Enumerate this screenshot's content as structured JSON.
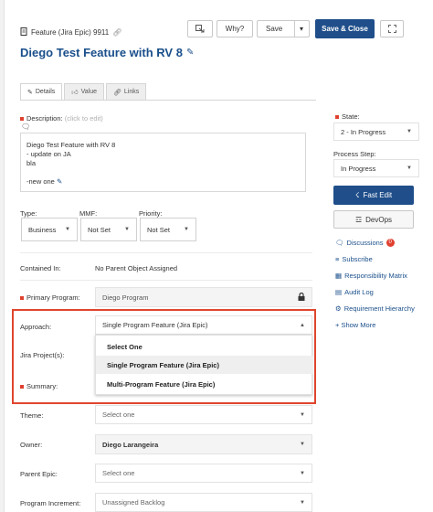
{
  "header": {
    "type_label": "Feature (Jira Epic) 9911",
    "title": "Diego Test Feature with RV 8",
    "buttons": {
      "why": "Why?",
      "save": "Save",
      "save_close": "Save & Close"
    }
  },
  "tabs": [
    {
      "label": "Details",
      "icon": "pencil-icon"
    },
    {
      "label": "Value",
      "icon": "thumbs-up-icon"
    },
    {
      "label": "Links",
      "icon": "link-icon"
    }
  ],
  "description": {
    "label": "Description:",
    "hint": "(click to edit)",
    "lines": [
      "Diego Test Feature with RV 8",
      "- update on JA",
      "bla",
      "",
      "-new one"
    ]
  },
  "fields": {
    "type": {
      "label": "Type:",
      "value": "Business"
    },
    "mmf": {
      "label": "MMF:",
      "value": "Not Set"
    },
    "priority": {
      "label": "Priority:",
      "value": "Not Set"
    },
    "contained_in": {
      "label": "Contained In:",
      "value": "No Parent Object Assigned"
    },
    "primary_program": {
      "label": "Primary Program:",
      "value": "Diego Program"
    },
    "approach": {
      "label": "Approach:",
      "value": "Single Program Feature (Jira Epic)"
    },
    "jira_projects": {
      "label": "Jira Project(s):"
    },
    "summary": {
      "label": "Summary:"
    },
    "theme": {
      "label": "Theme:",
      "value": "Select one"
    },
    "owner": {
      "label": "Owner:",
      "value": "Diego Larangeira"
    },
    "parent_epic": {
      "label": "Parent Epic:",
      "value": "Select one"
    },
    "program_increment": {
      "label": "Program Increment:",
      "value": "Unassigned Backlog"
    }
  },
  "approach_dropdown": {
    "options": [
      "Select One",
      "Single Program Feature (Jira Epic)",
      "Multi-Program Feature (Jira Epic)"
    ],
    "selected": "Single Program Feature (Jira Epic)"
  },
  "sidebar": {
    "state": {
      "label": "State:",
      "value": "2 - In Progress"
    },
    "process_step": {
      "label": "Process Step:",
      "value": "In Progress"
    },
    "fast_edit": "Fast Edit",
    "devops": "DevOps",
    "links": [
      {
        "label": "Discussions",
        "icon": "chat-icon",
        "badge": "0"
      },
      {
        "label": "Subscribe",
        "icon": "rss-icon"
      },
      {
        "label": "Responsibility Matrix",
        "icon": "grid-icon"
      },
      {
        "label": "Audit Log",
        "icon": "audit-log-icon"
      },
      {
        "label": "Requirement Hierarchy",
        "icon": "hierarchy-icon"
      },
      {
        "label": "+ Show More",
        "icon": ""
      }
    ]
  },
  "colors": {
    "primary": "#1f4e8a",
    "title": "#1a4f8b",
    "required": "#e04030",
    "highlight_box": "#e0452f"
  }
}
